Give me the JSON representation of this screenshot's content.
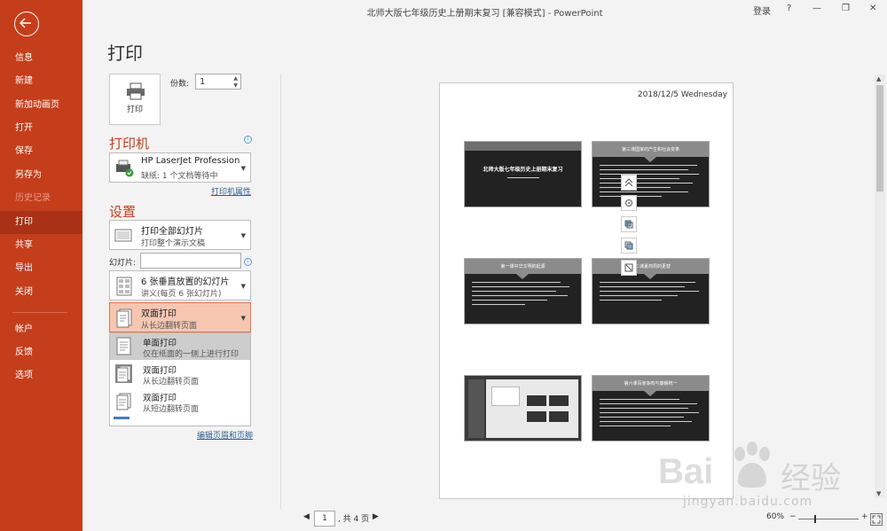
{
  "window": {
    "title": "北师大版七年级历史上册期末复习 [兼容模式] - PowerPoint",
    "signin": "登录",
    "help": "?",
    "minimize": "—",
    "restore": "❐",
    "close": "✕"
  },
  "sidebar": {
    "items": [
      {
        "label": "信息"
      },
      {
        "label": "新建"
      },
      {
        "label": "新加动画页"
      },
      {
        "label": "打开"
      },
      {
        "label": "保存"
      },
      {
        "label": "另存为"
      },
      {
        "label": "历史记录"
      },
      {
        "label": "打印"
      },
      {
        "label": "共享"
      },
      {
        "label": "导出"
      },
      {
        "label": "关闭"
      },
      {
        "label": "帐户"
      },
      {
        "label": "反馈"
      },
      {
        "label": "选项"
      }
    ]
  },
  "print": {
    "title": "打印",
    "button_label": "打印",
    "copies_label": "份数:",
    "copies_value": "1"
  },
  "printer": {
    "heading": "打印机",
    "name": "HP LaserJet Professional...",
    "status": "缺纸: 1 个文档等待中",
    "properties_link": "打印机属性"
  },
  "settings": {
    "heading": "设置",
    "range": {
      "title": "打印全部幻灯片",
      "subtitle": "打印整个演示文稿"
    },
    "slides_label": "幻灯片:",
    "slides_value": "",
    "layout": {
      "title": "6 张垂直放置的幻灯片",
      "subtitle": "讲义(每页 6 张幻灯片)"
    },
    "duplex": {
      "title": "双面打印",
      "subtitle": "从长边翻转页面"
    },
    "menu": [
      {
        "title": "单面打印",
        "subtitle": "仅在纸面的一侧上进行打印"
      },
      {
        "title": "双面打印",
        "subtitle": "从长边翻转页面"
      },
      {
        "title": "双面打印",
        "subtitle": "从短边翻转页面"
      }
    ],
    "edit_link": "编辑页眉和页脚"
  },
  "preview": {
    "date": "2018/12/5 Wednesday",
    "slides": [
      {
        "title": "北师大版七年级历史上册期末复习"
      },
      {
        "title": "第三课国家的产生和社会变革"
      },
      {
        "title": "第一课中华文明的起源"
      },
      {
        "title": "第二课夏商周的更替"
      },
      {
        "title": ""
      },
      {
        "title": "第六课百家争鸣与秦朝统一"
      }
    ]
  },
  "pager": {
    "current": "1",
    "total_text": ", 共 4 页"
  },
  "zoom": {
    "level": "60%",
    "minus": "−",
    "plus": "+"
  },
  "watermark": {
    "brand": "Bai",
    "suffix": "经验",
    "url": "jingyan.baidu.com"
  }
}
